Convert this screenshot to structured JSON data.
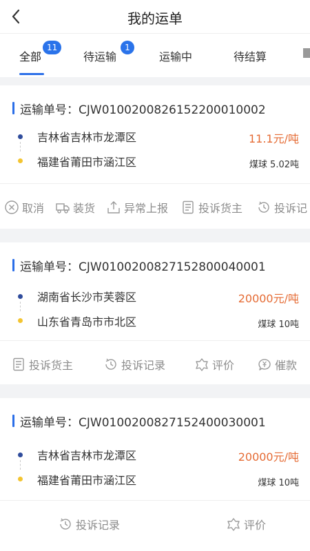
{
  "header": {
    "title": "我的运单"
  },
  "tabs": [
    {
      "label": "全部",
      "badge": "11"
    },
    {
      "label": "待运输",
      "badge": "1"
    },
    {
      "label": "运输中"
    },
    {
      "label": "待结算"
    },
    {
      "label": "",
      "note": "partially cut off tab at edge"
    }
  ],
  "cards": [
    {
      "waybill_label": "运输单号：CJW010020082615220001000",
      "waybill_label_full": "运输单号：CJW0100200826152200010002",
      "from": "吉林省吉林市龙潭区",
      "to": "福建省莆田市涵江区",
      "price": "11.1元/吨",
      "goods": "煤球  5.02吨",
      "actions": [
        "取消",
        "装货",
        "异常上报",
        "投诉货主",
        "投诉记"
      ]
    },
    {
      "waybill_label_full": "运输单号：CJW0100200827152800040001",
      "from": "湖南省长沙市芙蓉区",
      "to": "山东省青岛市市北区",
      "price": "20000元/吨",
      "goods": "煤球  10吨",
      "actions": [
        "投诉货主",
        "投诉记录",
        "评价",
        "催款"
      ]
    },
    {
      "waybill_label_full": "运输单号：CJW0100200827152400030001",
      "from": "吉林省吉林市龙潭区",
      "to": "福建省莆田市涵江区",
      "price": "20000元/吨",
      "goods": "煤球  10吨",
      "actions": [
        "投诉记录",
        "评价"
      ]
    }
  ]
}
